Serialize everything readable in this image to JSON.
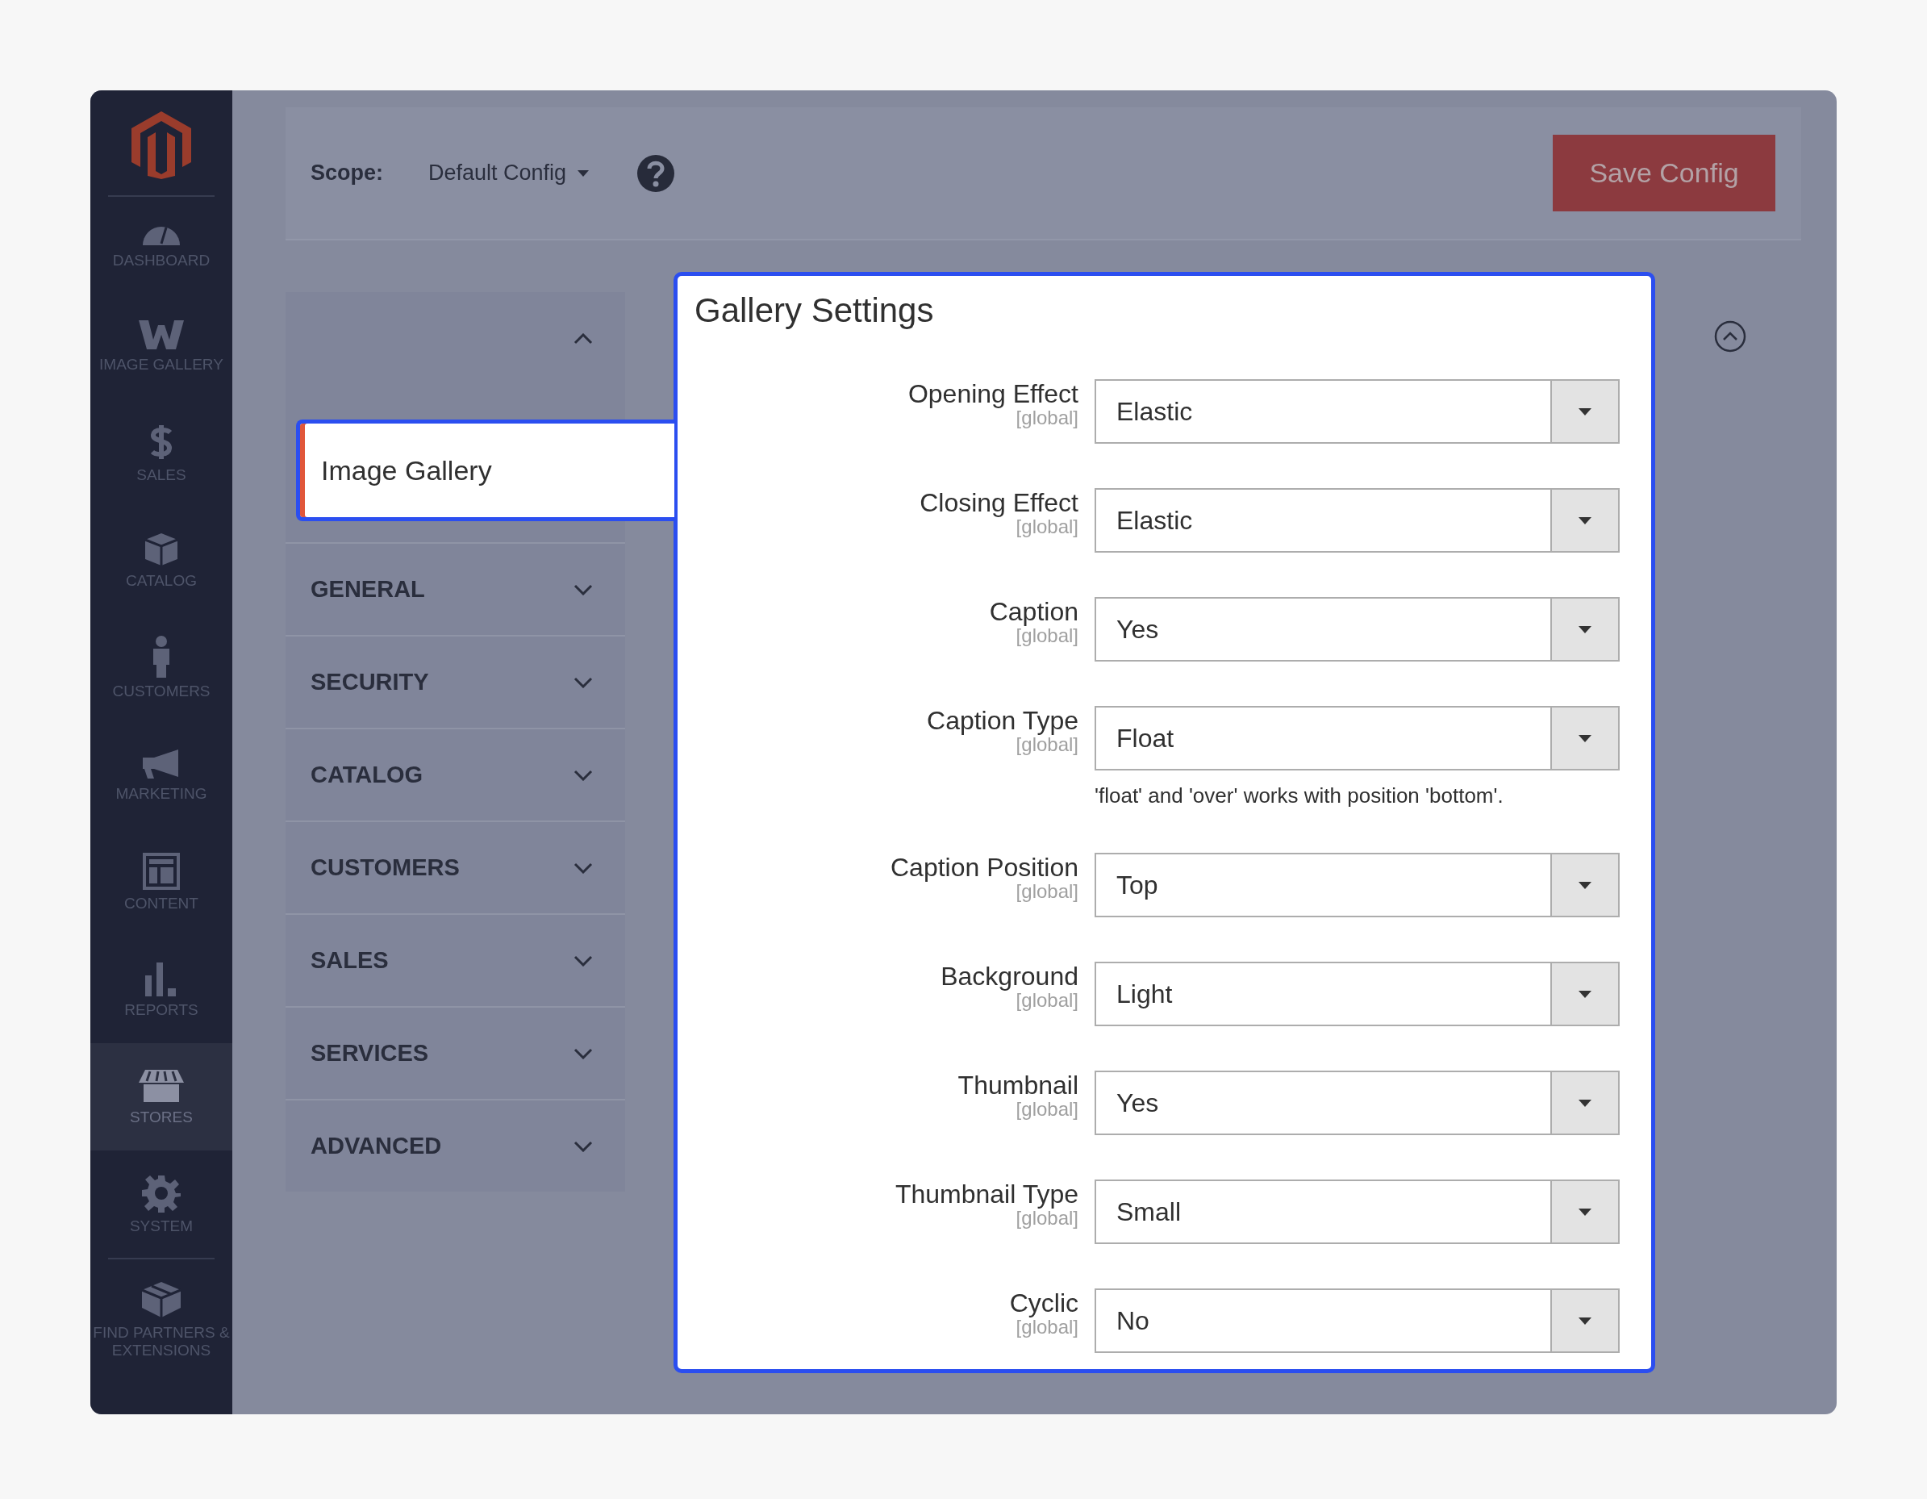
{
  "sidebar": {
    "items": [
      {
        "label": "DASHBOARD",
        "selected": false
      },
      {
        "label": "IMAGE GALLERY",
        "selected": false
      },
      {
        "label": "SALES",
        "selected": false
      },
      {
        "label": "CATALOG",
        "selected": false
      },
      {
        "label": "CUSTOMERS",
        "selected": false
      },
      {
        "label": "MARKETING",
        "selected": false
      },
      {
        "label": "CONTENT",
        "selected": false
      },
      {
        "label": "REPORTS",
        "selected": false
      },
      {
        "label": "STORES",
        "selected": true
      },
      {
        "label": "SYSTEM",
        "selected": false
      },
      {
        "label": "FIND PARTNERS & EXTENSIONS",
        "selected": false
      }
    ]
  },
  "toolbar": {
    "scope_label": "Scope:",
    "scope_value": "Default Config",
    "save_button": "Save Config"
  },
  "config_nav": {
    "top_group": {
      "expanded": true,
      "items": [
        {
          "label": "Image Gallery",
          "selected": true
        }
      ]
    },
    "sections": [
      {
        "label": "GENERAL",
        "expanded": false
      },
      {
        "label": "SECURITY",
        "expanded": false
      },
      {
        "label": "CATALOG",
        "expanded": false
      },
      {
        "label": "CUSTOMERS",
        "expanded": false
      },
      {
        "label": "SALES",
        "expanded": false
      },
      {
        "label": "SERVICES",
        "expanded": false
      },
      {
        "label": "ADVANCED",
        "expanded": false
      }
    ]
  },
  "panel": {
    "title": "Gallery Settings",
    "expanded": true,
    "fields": [
      {
        "label": "Opening Effect",
        "scope": "[global]",
        "value": "Elastic"
      },
      {
        "label": "Closing Effect",
        "scope": "[global]",
        "value": "Elastic"
      },
      {
        "label": "Caption",
        "scope": "[global]",
        "value": "Yes"
      },
      {
        "label": "Caption Type",
        "scope": "[global]",
        "value": "Float",
        "hint": "'float' and 'over' works with position 'bottom'."
      },
      {
        "label": "Caption Position",
        "scope": "[global]",
        "value": "Top"
      },
      {
        "label": "Background",
        "scope": "[global]",
        "value": "Light"
      },
      {
        "label": "Thumbnail",
        "scope": "[global]",
        "value": "Yes"
      },
      {
        "label": "Thumbnail Type",
        "scope": "[global]",
        "value": "Small"
      },
      {
        "label": "Cyclic",
        "scope": "[global]",
        "value": "No"
      }
    ]
  }
}
